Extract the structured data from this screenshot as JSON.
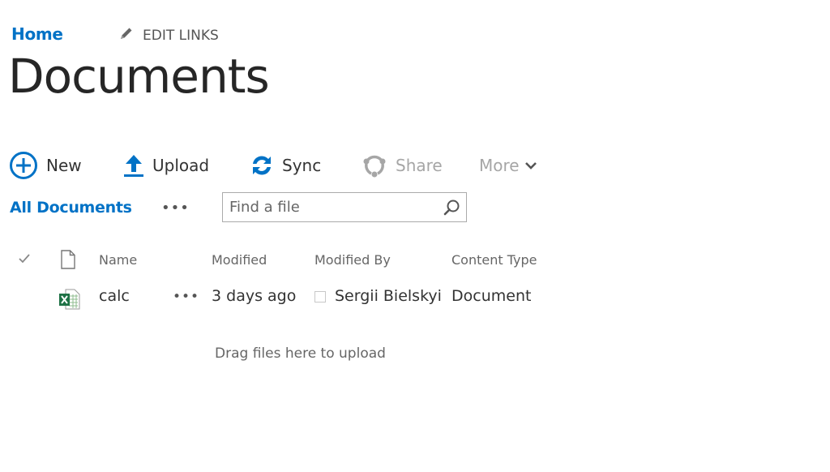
{
  "topnav": {
    "home_label": "Home",
    "edit_links_label": "EDIT LINKS",
    "edit_icon": "pencil-icon"
  },
  "page": {
    "title": "Documents"
  },
  "commands": [
    {
      "label": "New",
      "icon": "plus-circle-icon",
      "enabled": true
    },
    {
      "label": "Upload",
      "icon": "upload-arrow-icon",
      "enabled": true
    },
    {
      "label": "Sync",
      "icon": "sync-icon",
      "enabled": true
    },
    {
      "label": "Share",
      "icon": "share-icon",
      "enabled": false
    },
    {
      "label": "More",
      "icon": "chevron-down-icon",
      "enabled": false
    }
  ],
  "views": {
    "current": "All Documents",
    "more_label": "•••"
  },
  "search": {
    "placeholder": "Find a file",
    "value": "",
    "icon": "search-icon"
  },
  "table": {
    "columns": [
      "Name",
      "Modified",
      "Modified By",
      "Content Type"
    ],
    "rows": [
      {
        "file_type": "excel",
        "name": "calc",
        "actions": "•••",
        "modified": "3 days ago",
        "modified_by": "Sergii Bielskyi",
        "content_type": "Document"
      }
    ]
  },
  "drop_hint": "Drag files here to upload",
  "colors": {
    "accent": "#0072c6",
    "disabled": "#a6a6a6",
    "excel_green": "#1e7145"
  }
}
